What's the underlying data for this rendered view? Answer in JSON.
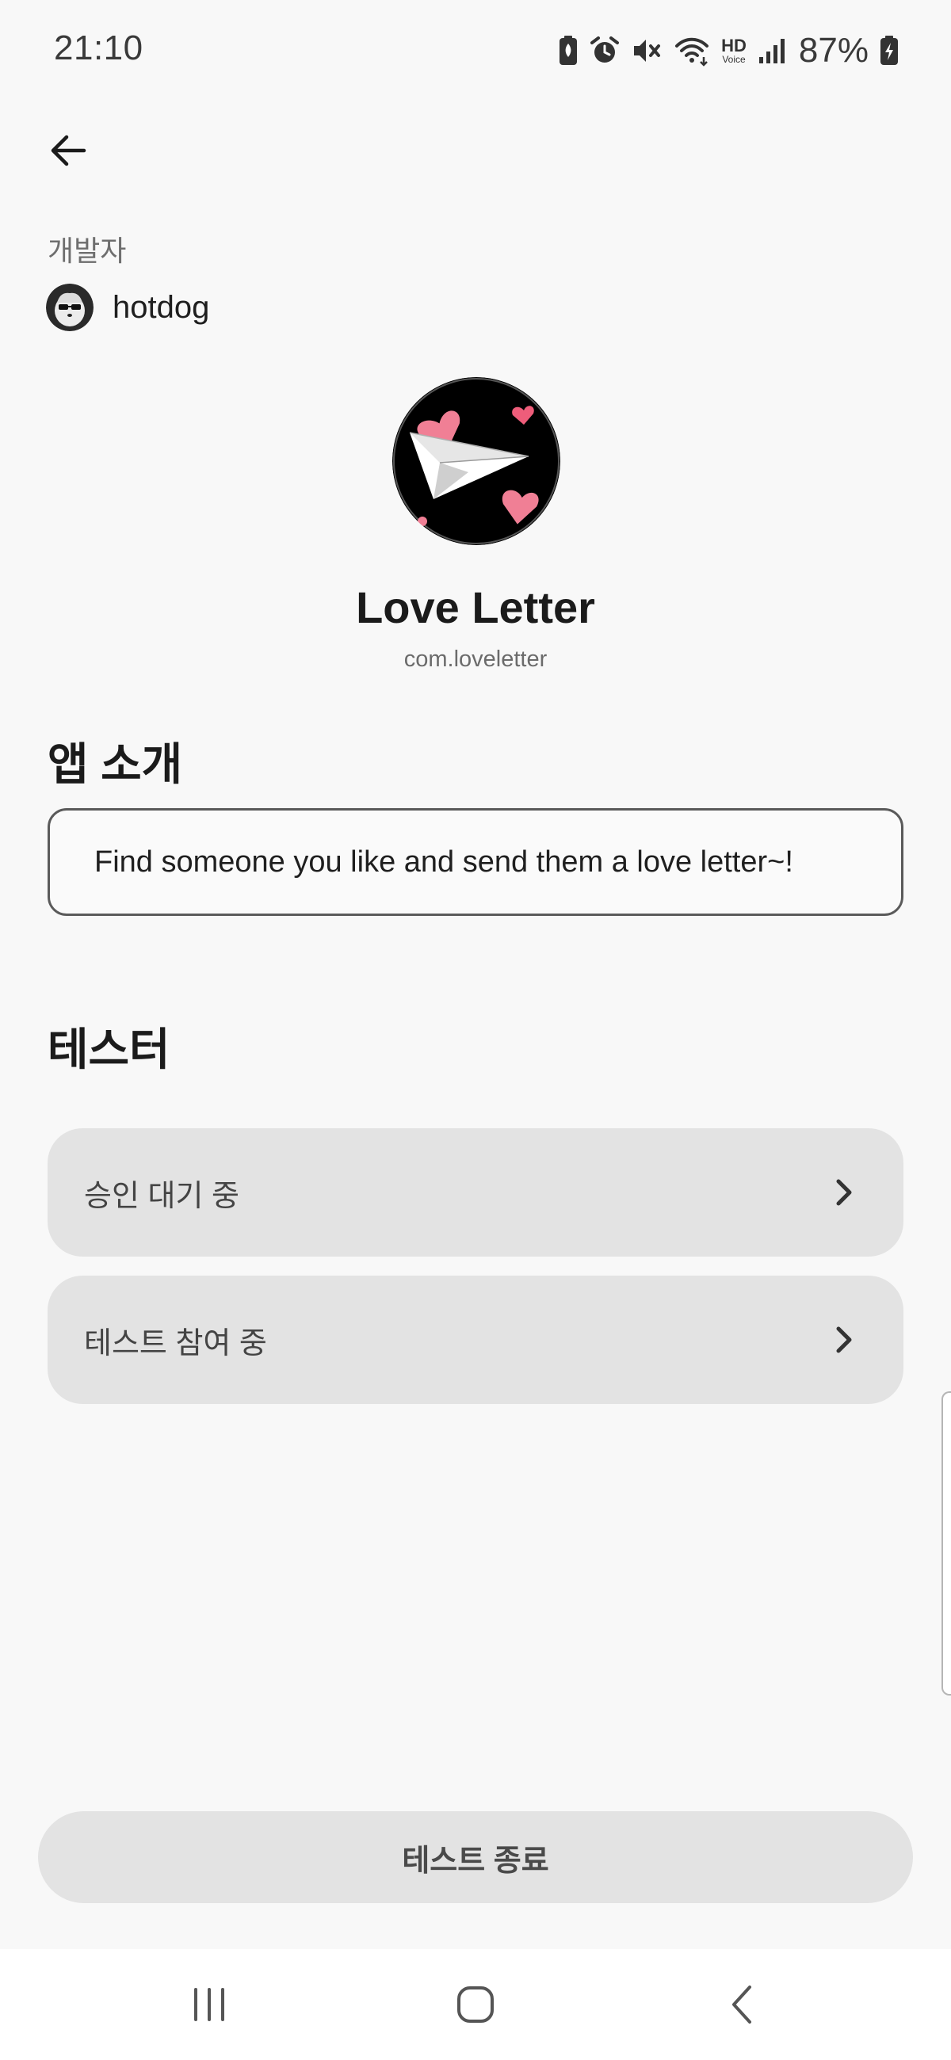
{
  "status_bar": {
    "time": "21:10",
    "battery_percent": "87%",
    "icons": [
      "battery-saver-icon",
      "alarm-icon",
      "mute-icon",
      "wifi-icon",
      "hd-voice-icon",
      "signal-icon",
      "battery-charging-icon"
    ],
    "hd_voice_label": "HD",
    "hd_voice_sub": "Voice"
  },
  "header": {
    "back_icon": "arrow-left-icon"
  },
  "developer": {
    "label": "개발자",
    "name": "hotdog"
  },
  "app": {
    "name": "Love Letter",
    "package": "com.loveletter"
  },
  "intro": {
    "title": "앱 소개",
    "text": "Find someone you like and send them a love letter~!"
  },
  "testers": {
    "title": "테스터",
    "items": [
      {
        "label": "승인 대기 중",
        "icon": "chevron-right-icon"
      },
      {
        "label": "테스트 참여 중",
        "icon": "chevron-right-icon"
      }
    ]
  },
  "actions": {
    "end_test_label": "테스트 종료"
  },
  "nav_bar": {
    "icons": [
      "recent-apps-icon",
      "home-icon",
      "back-icon"
    ]
  },
  "colors": {
    "background": "#f8f8f8",
    "card": "#e3e3e3",
    "heart_pink": "#f07f95"
  }
}
